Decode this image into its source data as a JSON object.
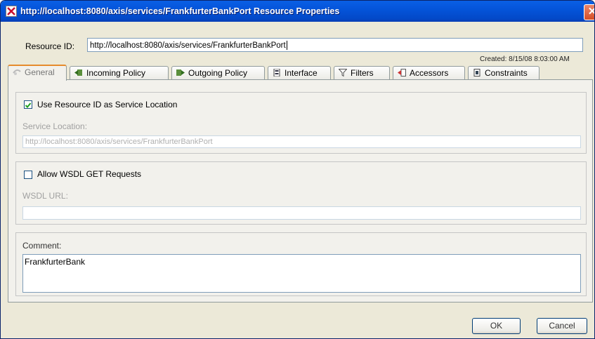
{
  "window": {
    "title": "http://localhost:8080/axis/services/FrankfurterBankPort Resource Properties",
    "close_glyph": "✕"
  },
  "resource": {
    "label": "Resource ID:",
    "value": "http://localhost:8080/axis/services/FrankfurterBankPort",
    "created": "Created: 8/15/08 8:03:00 AM"
  },
  "tabs": [
    {
      "label": "General",
      "icon": "general-icon",
      "active": true
    },
    {
      "label": "Incoming Policy",
      "icon": "incoming-policy-icon"
    },
    {
      "label": "Outgoing Policy",
      "icon": "outgoing-policy-icon"
    },
    {
      "label": "Interface",
      "icon": "interface-icon"
    },
    {
      "label": "Filters",
      "icon": "filter-icon"
    },
    {
      "label": "Accessors",
      "icon": "accessors-icon"
    },
    {
      "label": "Constraints",
      "icon": "constraints-icon"
    }
  ],
  "general": {
    "use_resource_id": {
      "label": "Use Resource ID as Service Location",
      "checked": true
    },
    "service_location": {
      "label": "Service Location:",
      "value": "http://localhost:8080/axis/services/FrankfurterBankPort"
    },
    "allow_wsdl": {
      "label": "Allow WSDL GET Requests",
      "checked": false
    },
    "wsdl_url": {
      "label": "WSDL URL:",
      "value": ""
    },
    "comment": {
      "label": "Comment:",
      "value": "FrankfurterBank"
    }
  },
  "buttons": {
    "ok": "OK",
    "cancel": "Cancel"
  },
  "colors": {
    "titlebar": "#0453d8",
    "tab_highlight": "#e68b2c",
    "dialog_bg": "#ece9d8"
  }
}
